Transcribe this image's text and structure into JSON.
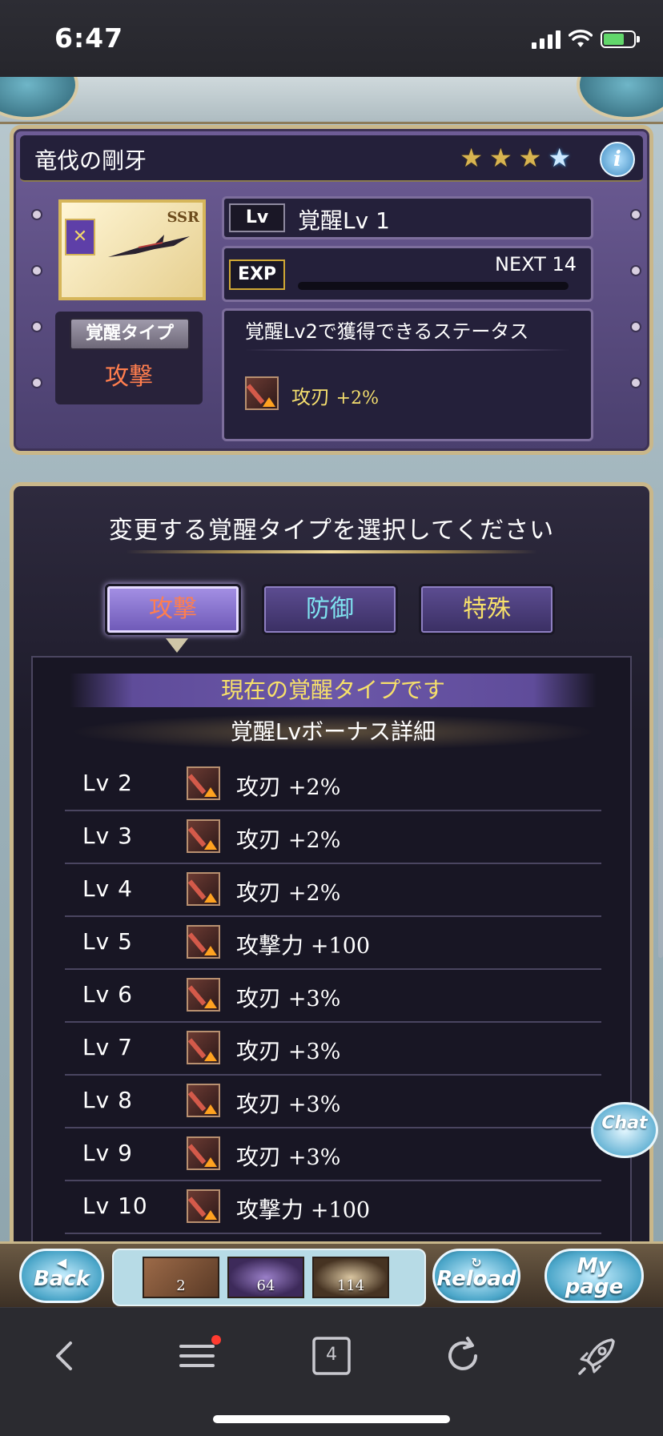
{
  "status_bar": {
    "time": "6:47"
  },
  "weapon": {
    "name": "竜伐の剛牙",
    "rarity": "SSR",
    "stars_filled": 3,
    "stars_total": 4,
    "awaken_type_label": "覚醒タイプ",
    "awaken_type_value": "攻撃",
    "level_tag": "Lv",
    "level_text": "覚醒Lv 1",
    "exp_tag": "EXP",
    "exp_next": "NEXT 14",
    "exp_progress": 0,
    "next_status_title": "覚醒Lv2で獲得できるステータス",
    "next_status": {
      "name": "攻刃",
      "value": "+2%"
    }
  },
  "selector": {
    "title": "変更する覚醒タイプを選択してください",
    "tabs": [
      {
        "label": "攻撃",
        "selected": true
      },
      {
        "label": "防御",
        "selected": false
      },
      {
        "label": "特殊",
        "selected": false
      }
    ],
    "current_banner": "現在の覚醒タイプです",
    "bonus_title": "覚醒Lvボーナス詳細",
    "rows": [
      {
        "lv": "Lv 2",
        "name": "攻刃",
        "value": "+2%"
      },
      {
        "lv": "Lv 3",
        "name": "攻刃",
        "value": "+2%"
      },
      {
        "lv": "Lv 4",
        "name": "攻刃",
        "value": "+2%"
      },
      {
        "lv": "Lv 5",
        "name": "攻撃力",
        "value": "+100"
      },
      {
        "lv": "Lv 6",
        "name": "攻刃",
        "value": "+3%"
      },
      {
        "lv": "Lv 7",
        "name": "攻刃",
        "value": "+3%"
      },
      {
        "lv": "Lv 8",
        "name": "攻刃",
        "value": "+3%"
      },
      {
        "lv": "Lv 9",
        "name": "攻刃",
        "value": "+3%"
      },
      {
        "lv": "Lv 10",
        "name": "攻撃力",
        "value": "+100"
      }
    ]
  },
  "chat_label": "Chat",
  "footer": {
    "back": "Back",
    "reload": "Reload",
    "mypage_1": "My",
    "mypage_2": "page",
    "items": [
      "2",
      "64",
      "114"
    ]
  },
  "browser": {
    "tab_count": "4"
  },
  "colors": {
    "attack": "#ff7e4e",
    "defense": "#7fe3f0",
    "special": "#f7e06a",
    "frame_gold": "#c9b78a"
  }
}
